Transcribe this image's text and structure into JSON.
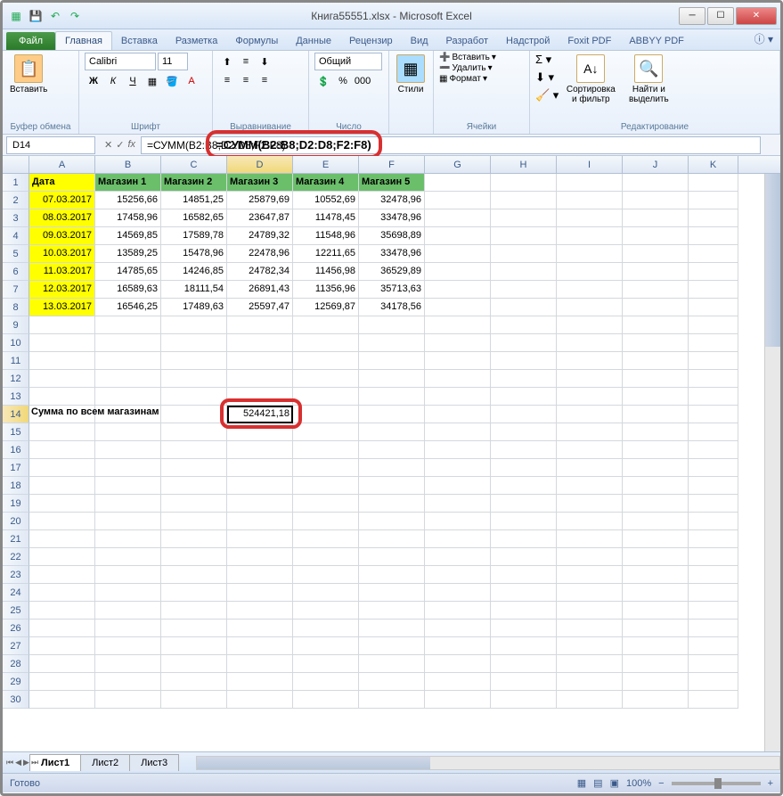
{
  "title": "Книга55551.xlsx - Microsoft Excel",
  "ribbon": {
    "file": "Файл",
    "tabs": [
      "Главная",
      "Вставка",
      "Разметка",
      "Формулы",
      "Данные",
      "Рецензир",
      "Вид",
      "Разработ",
      "Надстрой",
      "Foxit PDF",
      "ABBYY PDF"
    ],
    "active": 0,
    "groups": {
      "clipboard": {
        "label": "Буфер обмена",
        "paste": "Вставить"
      },
      "font": {
        "label": "Шрифт",
        "name": "Calibri",
        "size": "11"
      },
      "alignment": {
        "label": "Выравнивание"
      },
      "number": {
        "label": "Число",
        "format": "Общий"
      },
      "styles": {
        "label": "Стили",
        "btn": "Стили"
      },
      "cells": {
        "label": "Ячейки",
        "insert": "Вставить",
        "delete": "Удалить",
        "format": "Формат"
      },
      "editing": {
        "label": "Редактирование",
        "sort": "Сортировка и фильтр",
        "find": "Найти и выделить"
      }
    }
  },
  "formula_bar": {
    "cell_ref": "D14",
    "formula": "=СУММ(B2:B8;D2:D8;F2:F8)"
  },
  "columns": [
    "A",
    "B",
    "C",
    "D",
    "E",
    "F",
    "G",
    "H",
    "I",
    "J",
    "K"
  ],
  "header_row": [
    "Дата",
    "Магазин 1",
    "Магазин 2",
    "Магазин 3",
    "Магазин 4",
    "Магазин 5"
  ],
  "data_rows": [
    {
      "r": 2,
      "date": "07.03.2017",
      "v": [
        "15256,66",
        "14851,25",
        "25879,69",
        "10552,69",
        "32478,96"
      ]
    },
    {
      "r": 3,
      "date": "08.03.2017",
      "v": [
        "17458,96",
        "16582,65",
        "23647,87",
        "11478,45",
        "33478,96"
      ]
    },
    {
      "r": 4,
      "date": "09.03.2017",
      "v": [
        "14569,85",
        "17589,78",
        "24789,32",
        "11548,96",
        "35698,89"
      ]
    },
    {
      "r": 5,
      "date": "10.03.2017",
      "v": [
        "13589,25",
        "15478,96",
        "22478,96",
        "12211,65",
        "33478,96"
      ]
    },
    {
      "r": 6,
      "date": "11.03.2017",
      "v": [
        "14785,65",
        "14246,85",
        "24782,34",
        "11456,98",
        "36529,89"
      ]
    },
    {
      "r": 7,
      "date": "12.03.2017",
      "v": [
        "16589,63",
        "18111,54",
        "26891,43",
        "11356,96",
        "35713,63"
      ]
    },
    {
      "r": 8,
      "date": "13.03.2017",
      "v": [
        "16546,25",
        "17489,63",
        "25597,47",
        "12569,87",
        "34178,56"
      ]
    }
  ],
  "result": {
    "row": 14,
    "label": "Сумма по всем магазинам",
    "value": "524421,18"
  },
  "sheets": {
    "active": "Лист1",
    "tabs": [
      "Лист1",
      "Лист2",
      "Лист3"
    ]
  },
  "status": {
    "ready": "Готово",
    "zoom": "100%"
  }
}
